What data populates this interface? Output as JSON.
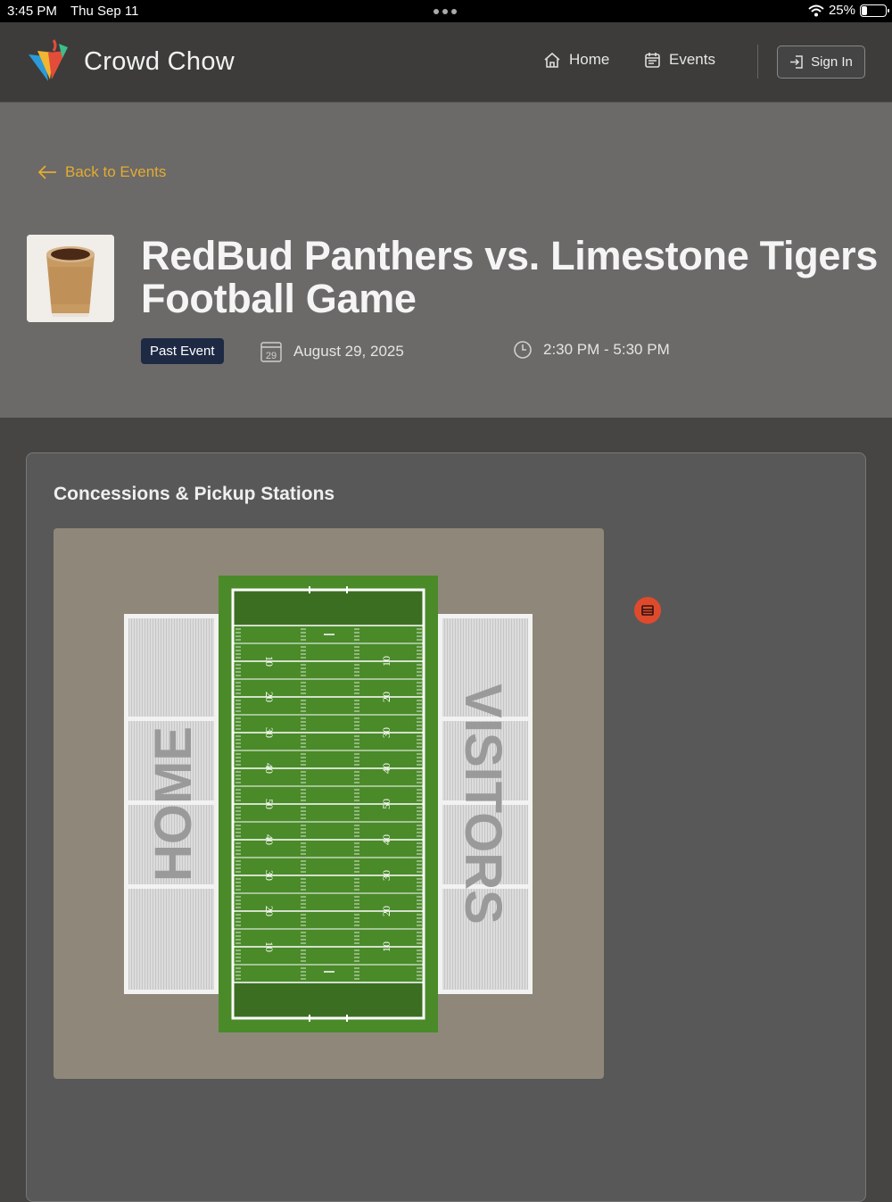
{
  "status_bar": {
    "time": "3:45 PM",
    "date": "Thu Sep 11",
    "battery": "25%",
    "battery_level": 0.25
  },
  "nav": {
    "brand": "Crowd Chow",
    "links": [
      {
        "label": "Home",
        "icon": "home-icon"
      },
      {
        "label": "Events",
        "icon": "calendar-icon"
      }
    ],
    "sign_in": "Sign In"
  },
  "event": {
    "back_label": "Back to Events",
    "title": "RedBud Panthers vs. Limestone Tigers Football Game",
    "badge": "Past Event",
    "date": "August 29, 2025",
    "calendar_day": "29",
    "time": "2:30 PM - 5:30 PM",
    "image": "coffee-cup"
  },
  "concessions": {
    "title": "Concessions & Pickup Stations",
    "stands": {
      "home": "HOME",
      "visitors": "VISITORS"
    },
    "yard_labels_left": [
      "10",
      "20",
      "30",
      "40",
      "50",
      "40",
      "30",
      "20",
      "10"
    ],
    "yard_labels_right": [
      "10",
      "20",
      "30",
      "40",
      "50",
      "40",
      "30",
      "20",
      "10"
    ],
    "station_marker_icon": "store-icon"
  },
  "colors": {
    "accent": "#e3ac2f",
    "badge": "#1e2a44",
    "turf": "#4a8a29",
    "endzone": "#3c6e22",
    "marker": "#e04a2c"
  }
}
